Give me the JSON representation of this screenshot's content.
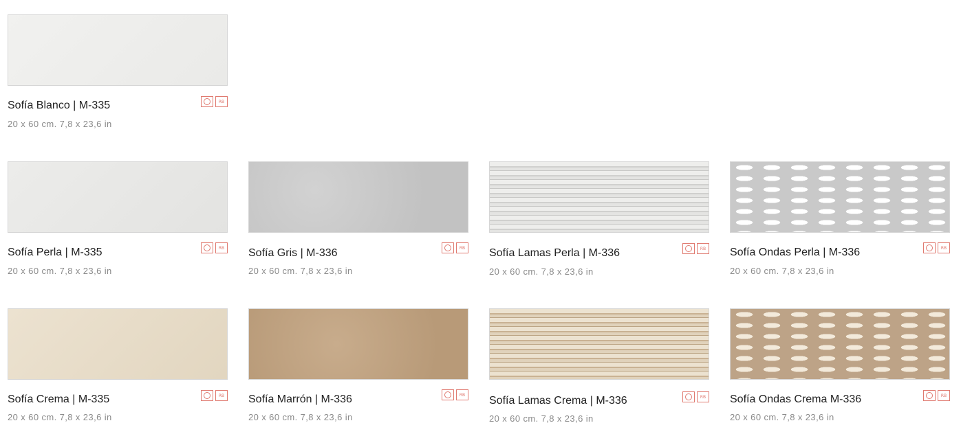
{
  "products": [
    {
      "name": "Sofía Blanco | M-335",
      "dims": "20 x 60 cm. 7,8 x 23,6 in",
      "texture": "blanco"
    },
    {
      "name": "Sofía Perla | M-335",
      "dims": "20 x 60 cm. 7,8 x 23,6 in",
      "texture": "perla"
    },
    {
      "name": "Sofía Gris | M-336",
      "dims": "20 x 60 cm. 7,8 x 23,6 in",
      "texture": "gris"
    },
    {
      "name": "Sofía Lamas Perla | M-336",
      "dims": "20 x 60 cm. 7,8 x 23,6 in",
      "texture": "lamas-perla"
    },
    {
      "name": "Sofía Ondas Perla | M-336",
      "dims": "20 x 60 cm. 7,8 x 23,6 in",
      "texture": "ondas-perla"
    },
    {
      "name": "Sofía Crema | M-335",
      "dims": "20 x 60 cm. 7,8 x 23,6 in",
      "texture": "crema"
    },
    {
      "name": "Sofía Marrón | M-336",
      "dims": "20 x 60 cm. 7,8 x 23,6 in",
      "texture": "marron"
    },
    {
      "name": "Sofía Lamas Crema | M-336",
      "dims": "20 x 60 cm. 7,8 x 23,6 in",
      "texture": "lamas-crema"
    },
    {
      "name": "Sofía Ondas Crema M-336",
      "dims": "20 x 60 cm. 7,8 x 23,6 in",
      "texture": "ondas-crema"
    }
  ],
  "icon_labels": {
    "rb": "RB"
  },
  "colors": {
    "accent": "#e07a70",
    "title": "#222222",
    "subtitle": "#8a8a8a"
  }
}
